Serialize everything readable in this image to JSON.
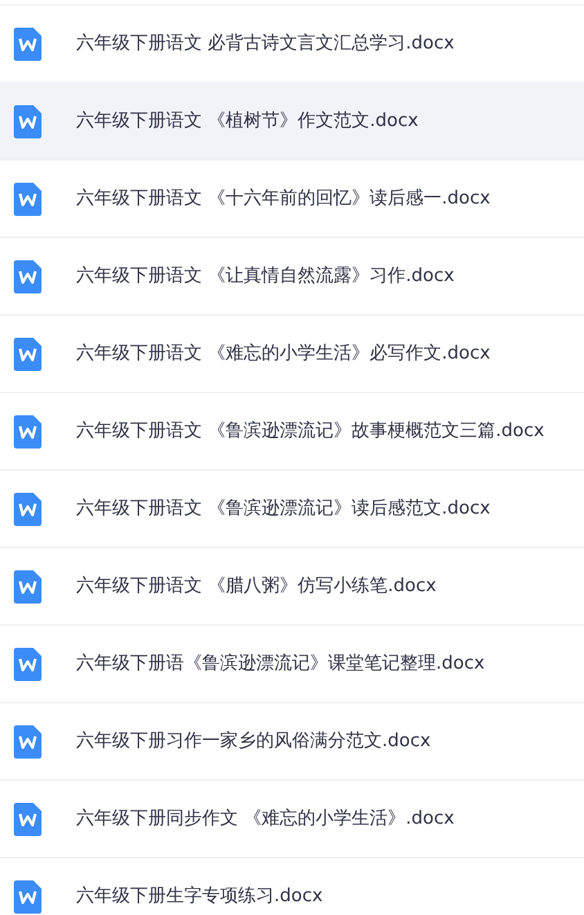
{
  "files": [
    {
      "name": "六年级下册语文 必背古诗文言文汇总学习.docx",
      "selected": false
    },
    {
      "name": "六年级下册语文 《植树节》作文范文.docx",
      "selected": true
    },
    {
      "name": "六年级下册语文 《十六年前的回忆》读后感一.docx",
      "selected": false
    },
    {
      "name": "六年级下册语文 《让真情自然流露》习作.docx",
      "selected": false
    },
    {
      "name": "六年级下册语文 《难忘的小学生活》必写作文.docx",
      "selected": false
    },
    {
      "name": "六年级下册语文 《鲁滨逊漂流记》故事梗概范文三篇.docx",
      "selected": false
    },
    {
      "name": "六年级下册语文 《鲁滨逊漂流记》读后感范文.docx",
      "selected": false
    },
    {
      "name": "六年级下册语文 《腊八粥》仿写小练笔.docx",
      "selected": false
    },
    {
      "name": "六年级下册语《鲁滨逊漂流记》课堂笔记整理.docx",
      "selected": false
    },
    {
      "name": "六年级下册习作一家乡的风俗满分范文.docx",
      "selected": false
    },
    {
      "name": "六年级下册同步作文 《难忘的小学生活》.docx",
      "selected": false
    },
    {
      "name": "六年级下册生字专项练习.docx",
      "selected": false
    }
  ]
}
